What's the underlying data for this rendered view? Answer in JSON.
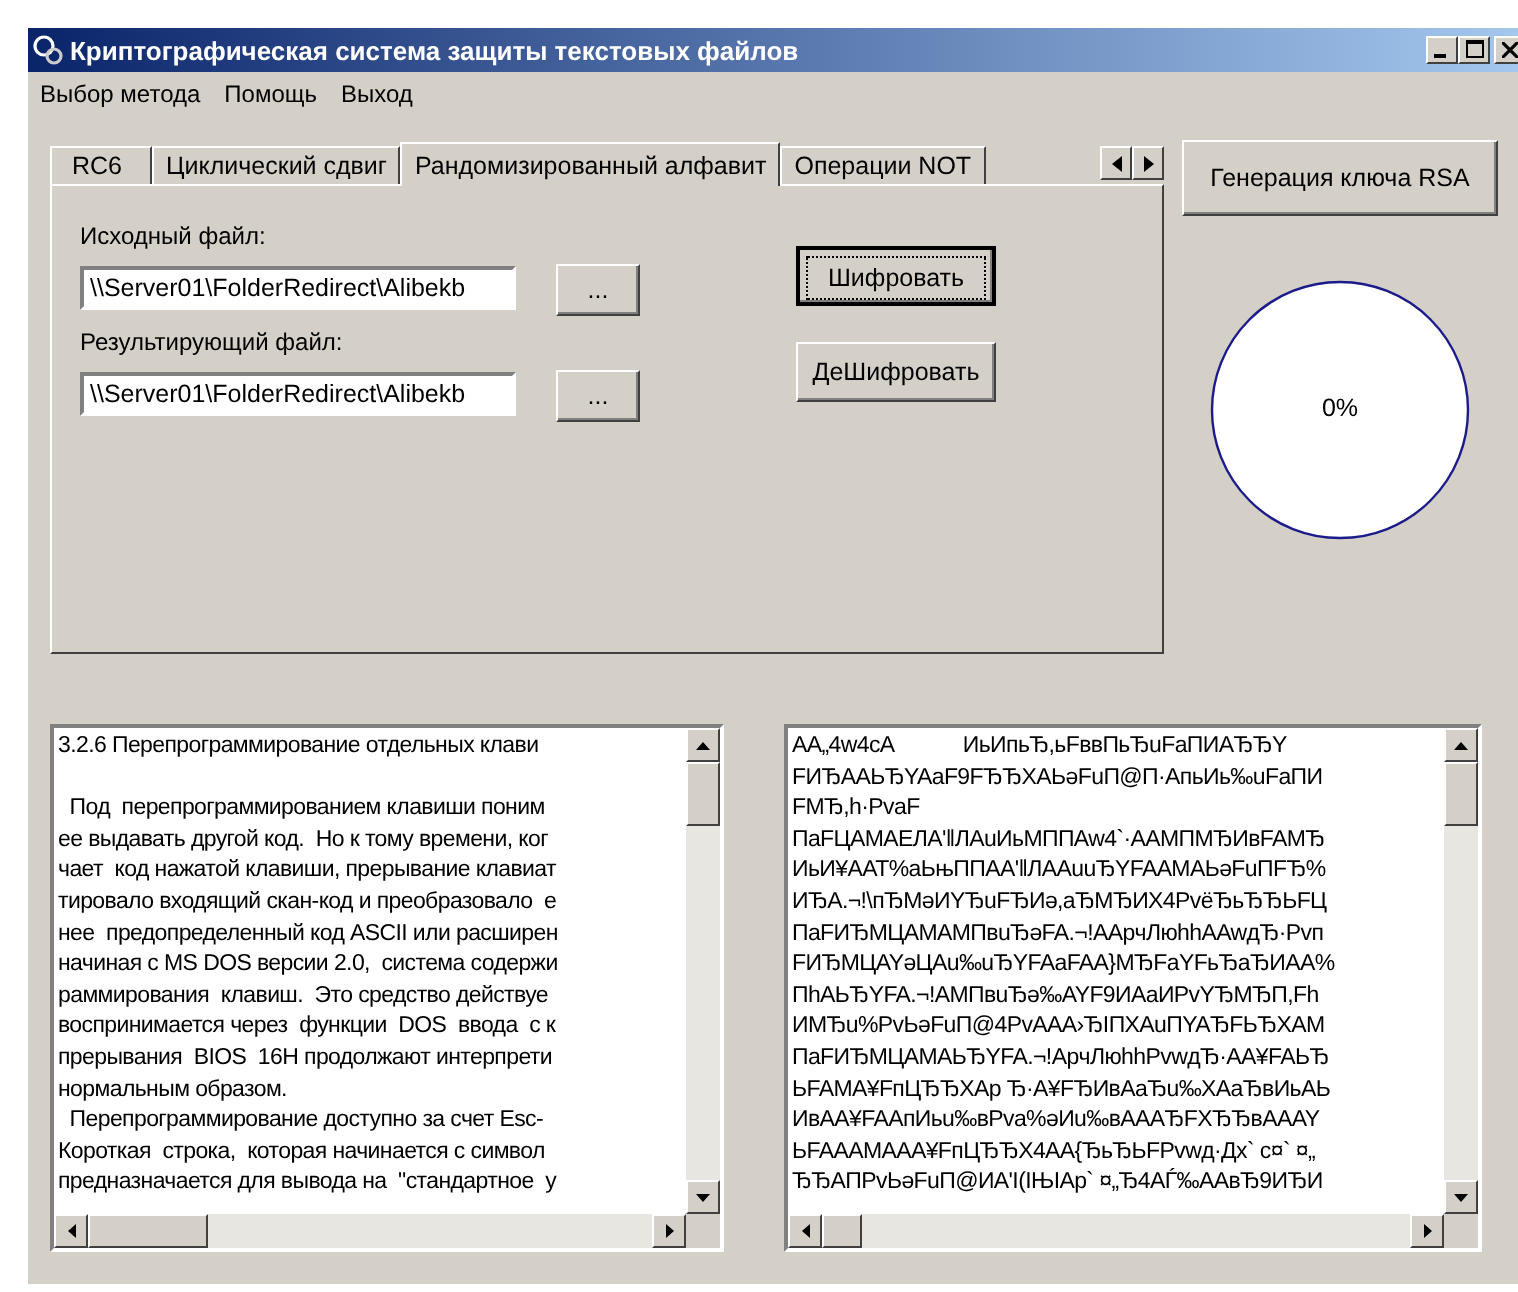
{
  "window": {
    "title": "Криптографическая система защиты текстовых файлов"
  },
  "menu": [
    "Выбор метода",
    "Помощь",
    "Выход"
  ],
  "tabs": [
    {
      "label": "RC6",
      "selected": false
    },
    {
      "label": "Циклический сдвиг",
      "selected": false
    },
    {
      "label": "Рандомизированный алфавит",
      "selected": true
    },
    {
      "label": "Операции NOT",
      "selected": false
    }
  ],
  "source": {
    "label": "Исходный файл:",
    "value": "\\\\Server01\\FolderRedirect\\Alibekb",
    "browse": "..."
  },
  "result": {
    "label": "Результирующий файл:",
    "value": "\\\\Server01\\FolderRedirect\\Alibekb",
    "browse": "..."
  },
  "actions": [
    {
      "label": "Шифровать",
      "focused": true
    },
    {
      "label": "ДеШифровать",
      "focused": false
    }
  ],
  "rsa_button": "Генерация ключа RSA",
  "progress": {
    "reading": "0%"
  },
  "source_text": [
    "3.2.6 Перепрограммирование отдельных клави",
    "  Под  перепрограммированием клавиши поним",
    "ее выдавать другой код.  Но к тому времени, ког",
    "чает  код нажатой клавиши, прерывание клавиат",
    "тировало входящий скан-код и преобразовало  е",
    "нее  предопределенный код ASCII или расширен",
    "начиная с MS DOS версии 2.0,  система содержи",
    "раммирования  клавиш.  Это средство действуе",
    "воспринимается через  функции  DOS  ввода  с к",
    "прерывания  BIOS  16H продолжают интерпрети",
    "нормальным образом.",
    "  Перепрограммирование доступно за счет Esc-",
    "Короткая  строка,  которая начинается с символ",
    "предназначается для вывода на  \"стандартное  у"
  ],
  "cipher_text": [
    "AA„4w4cA            ИьИпьЂ,ьFввПьЂuFaПИАЂЂY",
    "FИЂААЬЂYAaF9FЂЂXAЬәFuП@П·АпьИь‰uFaПИ",
    "FMЂ,h·PvaF",
    "ПaFЦAMAEЛA'‖ЛAuИьМППAw4`·AAMПMЂИвFAMЂ",
    "ИьИ¥AAT%aЬњППAA'‖ЛAAuuЂYFAAMAЬәFuПFЂ%",
    "ИЂA.¬!\\пЂМәИYЂuFЂИә,aЂМЂИX4PvёЂьЂЂЬFЦ",
    "ПaFИЂMЦAMAMПвuЂәFA.¬!AApчЛюhhAAwдЂ·Pvп",
    "FИЂMЦAYәЦAu‰uЂYFAaFAA}MЂFaYFьЂaЂИAA%",
    "ПhAЬЂYFA.¬!AMПвuЂә‰AYF9ИAaИPvYЂMЂП,Fh",
    "ИMЂu%PvЬәFuП@4PvAAA›ЂIПXAuПYAЂFЬЂXAM",
    "ПaFИЂMЦAMAЬЂYFA.¬!ApчЛюhhPvwдЂ·AA¥FAЬЂ",
    "ЬFAMA¥FпЦЂЂXAp Ђ·A¥FЂИвAaЂu‰XAaЂвИьAЬ",
    "ИвAA¥FAAпИьu‰вPva%әИu‰вAAAЂFXЂЂвAAAY",
    "ЬFAAAMAAA¥FпЦЂЂX4AA{ЂьЂЬFPvwд·Дх` с¤` ¤„",
    "ЂЂAПPvЬәFuП@ИA'I(IЊIAp` ¤„Ђ4AЃ‰AAвЂ9ИЂИ"
  ]
}
